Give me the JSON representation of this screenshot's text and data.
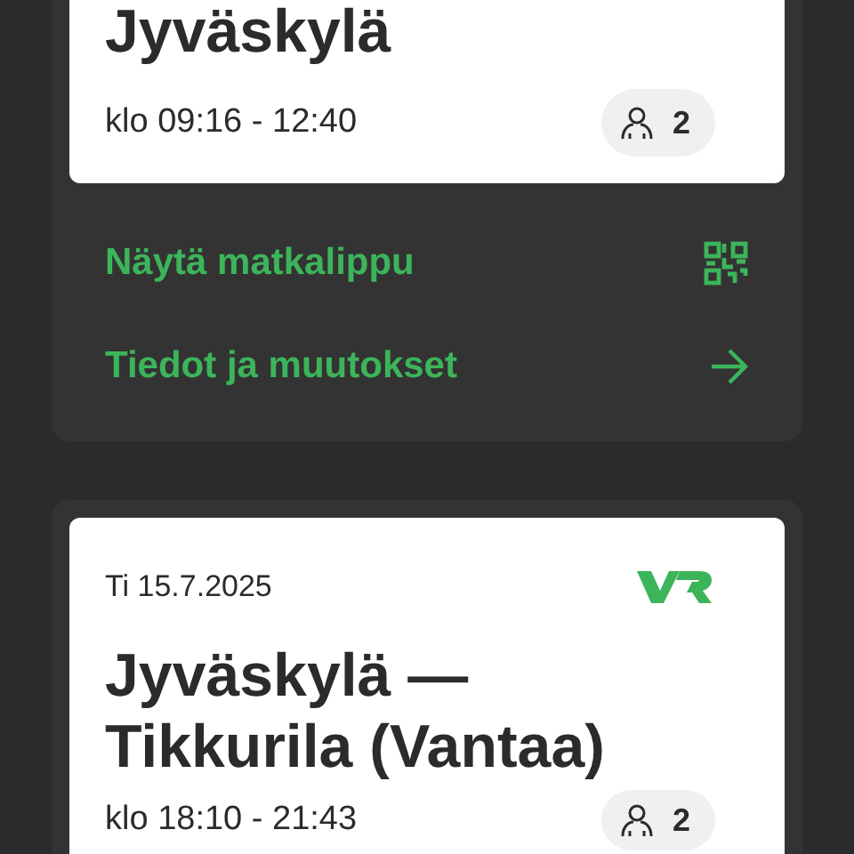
{
  "trips": [
    {
      "title": "Jyväskylä",
      "time": "klo 09:16 - 12:40",
      "passengers": "2",
      "actions": [
        {
          "kind": "ticket",
          "label": "Näytä matkalippu"
        },
        {
          "kind": "details",
          "label": "Tiedot ja muutokset"
        }
      ]
    },
    {
      "date": "Ti 15.7.2025",
      "title": "Jyväskylä —\nTikkurila (Vantaa)",
      "time": "klo 18:10 - 21:43",
      "passengers": "2"
    }
  ]
}
